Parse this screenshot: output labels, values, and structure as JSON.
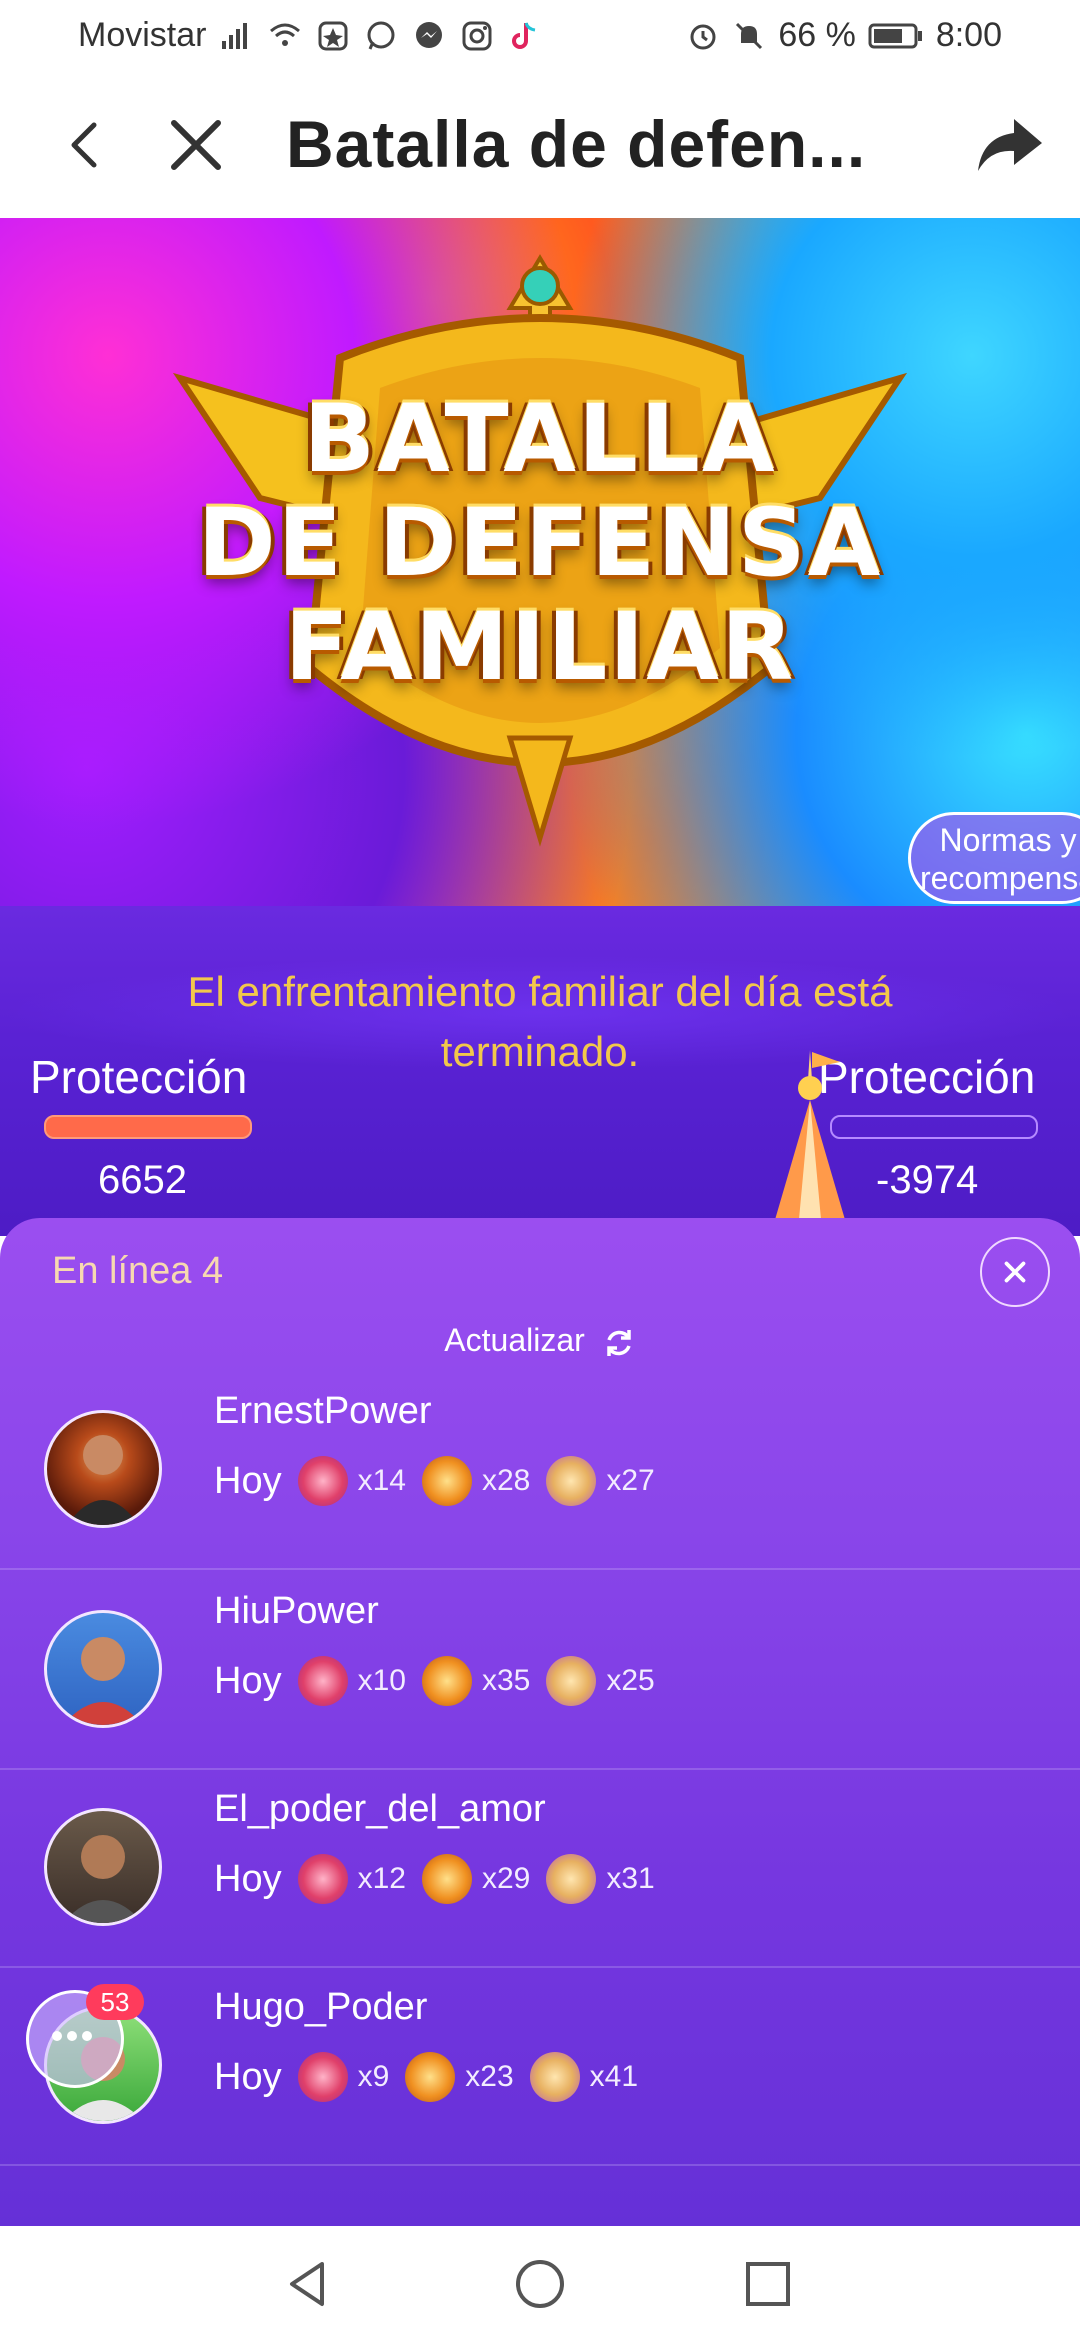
{
  "status_bar": {
    "carrier": "Movistar",
    "battery": "66 %",
    "time": "8:00"
  },
  "title_bar": {
    "title": "Batalla de defen..."
  },
  "banner": {
    "line1": "BATALLA",
    "line2": "DE DEFENSA",
    "line3": "FAMILIAR",
    "rules_button": "Normas y recompensa"
  },
  "battle": {
    "message": "El enfrentamiento familiar del día está terminado.",
    "left_label": "Protección",
    "left_score": "6652",
    "right_label": "Protección",
    "right_score": "-3974"
  },
  "online_sheet": {
    "title": "En línea 4",
    "refresh_label": "Actualizar",
    "users": [
      {
        "name": "ErnestPower",
        "day": "Hoy",
        "g1": "x14",
        "g2": "x28",
        "g3": "x27"
      },
      {
        "name": "HiuPower",
        "day": "Hoy",
        "g1": "x10",
        "g2": "x35",
        "g3": "x25"
      },
      {
        "name": "El_poder_del_amor",
        "day": "Hoy",
        "g1": "x12",
        "g2": "x29",
        "g3": "x31"
      },
      {
        "name": "Hugo_Poder",
        "day": "Hoy",
        "g1": "x9",
        "g2": "x23",
        "g3": "x41"
      }
    ],
    "chat_badge": "53"
  }
}
